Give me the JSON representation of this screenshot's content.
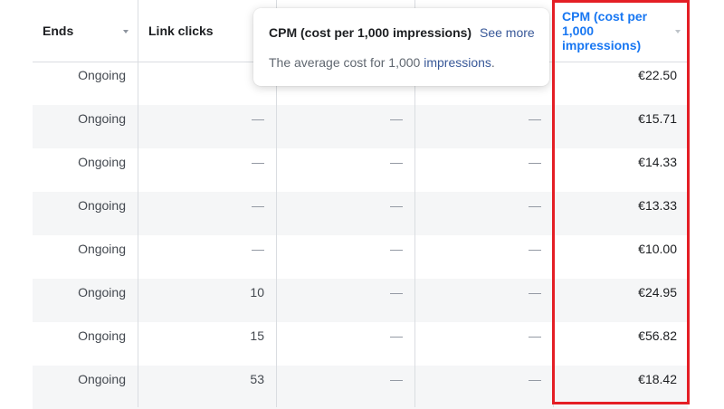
{
  "columns": {
    "ends": "Ends",
    "link_clicks": "Link clicks",
    "cpm": "CPM (cost per 1,000 impressions)"
  },
  "cpm_header_lines": [
    "CPM (cost per",
    "1,000",
    "impressions)"
  ],
  "tooltip": {
    "title": "CPM (cost per 1,000 impressions)",
    "link": "See more",
    "body_prefix": "The average cost for 1,000 ",
    "body_keyword": "impressions",
    "body_suffix": "."
  },
  "rows": [
    {
      "ends": "Ongoing",
      "link_clicks": "",
      "col3": "",
      "col4": "",
      "cpm": "€22.50"
    },
    {
      "ends": "Ongoing",
      "link_clicks": "—",
      "col3": "—",
      "col4": "—",
      "cpm": "€15.71"
    },
    {
      "ends": "Ongoing",
      "link_clicks": "—",
      "col3": "—",
      "col4": "—",
      "cpm": "€14.33"
    },
    {
      "ends": "Ongoing",
      "link_clicks": "—",
      "col3": "—",
      "col4": "—",
      "cpm": "€13.33"
    },
    {
      "ends": "Ongoing",
      "link_clicks": "—",
      "col3": "—",
      "col4": "—",
      "cpm": "€10.00"
    },
    {
      "ends": "Ongoing",
      "link_clicks": "10",
      "col3": "—",
      "col4": "—",
      "cpm": "€24.95"
    },
    {
      "ends": "Ongoing",
      "link_clicks": "15",
      "col3": "—",
      "col4": "—",
      "cpm": "€56.82"
    },
    {
      "ends": "Ongoing",
      "link_clicks": "53",
      "col3": "—",
      "col4": "—",
      "cpm": "€18.42"
    }
  ],
  "colors": {
    "highlight": "#e41e25",
    "cpm_header": "#1877f2",
    "link": "#385898"
  }
}
